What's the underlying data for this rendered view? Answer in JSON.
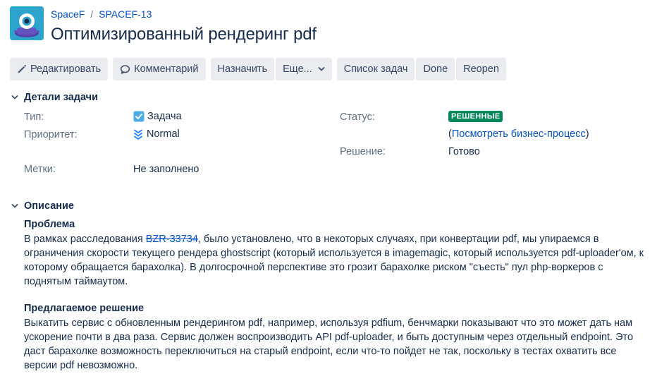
{
  "breadcrumb": {
    "project": "SpaceF",
    "separator": "/",
    "issue_key": "SPACEF-13"
  },
  "issue_title": "Оптимизированный рендеринг pdf",
  "toolbar": {
    "edit_label": "Редактировать",
    "comment_label": "Комментарий",
    "assign_label": "Назначить",
    "more_label": "Еще...",
    "backlog_label": "Список задач",
    "done_label": "Done",
    "reopen_label": "Reopen"
  },
  "details": {
    "section_title": "Детали задачи",
    "type_label": "Тип:",
    "type_value": "Задача",
    "priority_label": "Приоритет:",
    "priority_value": "Normal",
    "labels_label": "Метки:",
    "labels_value": "Не заполнено",
    "status_label": "Статус:",
    "status_value": "РЕШЕННЫЕ",
    "workflow_open": "(",
    "workflow_link": "Посмотреть бизнес-процесс",
    "workflow_close": ")",
    "resolution_label": "Решение:",
    "resolution_value": "Готово"
  },
  "description": {
    "section_title": "Описание",
    "problem_heading": "Проблема",
    "problem_text_before": "В рамках расследования ",
    "problem_link": "BZR-33734",
    "problem_text_after": ", было установлено, что в некоторых случаях, при конвертации pdf, мы упираемся в ограничения скорости текущего рендера ghostscript (который используется в imagemagic, который используется pdf-uploader'ом, к которому обращается барахолка). В долгосрочной перспективе это грозит барахолке риском \"съесть\" пул php-воркеров с поднятым таймаутом.",
    "solution_heading": "Предлагаемое решение",
    "solution_text": "Выкатить сервис с обновленным рендерингом pdf, например, используя pdfium, бенчмарки показывают что это может дать нам ускорение почти в два раза. Сервис должен воспроизводить API pdf-uploader, и быть доступным через отдельный endpoint. Это даст барахолке возможность переключиться на старый endpoint, если что-то пойдет не так, поскольку в тестах охватить все версии pdf невозможно."
  },
  "colors": {
    "link": "#0052cc",
    "resolved_lozenge": "#00875a",
    "button_bg": "#ebecf0",
    "avatar_bg": "#2da4ce"
  },
  "icons": [
    "project-avatar-icon",
    "pencil-icon",
    "comment-icon",
    "chevron-down-icon",
    "task-type-icon",
    "priority-normal-icon",
    "collapse-chevron-icon"
  ]
}
